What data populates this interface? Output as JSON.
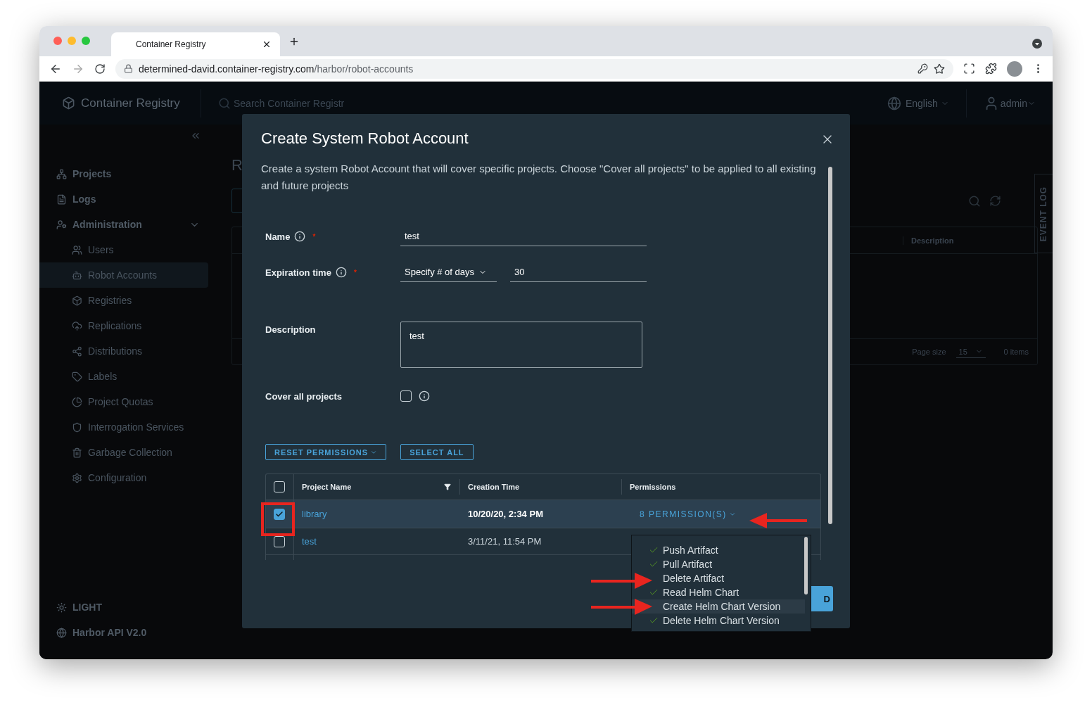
{
  "browser": {
    "tab_title": "Container Registry",
    "url_host": "determined-david.container-registry.com",
    "url_path": "/harbor/robot-accounts"
  },
  "app": {
    "brand": "Container Registry",
    "search_placeholder": "Search Container Registr",
    "language": "English",
    "user": "admin"
  },
  "sidebar": {
    "items": [
      {
        "label": "Projects",
        "kind": "top",
        "selected": false
      },
      {
        "label": "Logs",
        "kind": "top",
        "selected": false
      },
      {
        "label": "Administration",
        "kind": "group",
        "selected": false,
        "expanded": true,
        "children": [
          {
            "label": "Users",
            "selected": false
          },
          {
            "label": "Robot Accounts",
            "selected": true
          },
          {
            "label": "Registries",
            "selected": false
          },
          {
            "label": "Replications",
            "selected": false
          },
          {
            "label": "Distributions",
            "selected": false
          },
          {
            "label": "Labels",
            "selected": false
          },
          {
            "label": "Project Quotas",
            "selected": false
          },
          {
            "label": "Interrogation Services",
            "selected": false
          },
          {
            "label": "Garbage Collection",
            "selected": false
          },
          {
            "label": "Configuration",
            "selected": false
          }
        ]
      }
    ],
    "footer": [
      {
        "label": "LIGHT"
      },
      {
        "label": "Harbor API V2.0"
      }
    ]
  },
  "page": {
    "title": "R",
    "table": {
      "columns": [
        "Description"
      ],
      "page_size_label": "Page size",
      "page_size": "15",
      "item_count": "0 items"
    },
    "event_log": "EVENT LOG"
  },
  "modal": {
    "title": "Create System Robot Account",
    "description": "Create a system Robot Account that will cover specific projects. Choose \"Cover all projects\" to be applied to all existing and future projects",
    "fields": [
      {
        "kind": "text",
        "label": "Name",
        "info": true,
        "required_mark": "*",
        "value": "test"
      },
      {
        "kind": "expiration",
        "label": "Expiration time",
        "info": true,
        "required_mark": "*",
        "unit": "Specify # of days",
        "value": "30"
      },
      {
        "kind": "textarea",
        "label": "Description",
        "info": false,
        "value": "test"
      },
      {
        "kind": "checkbox",
        "label": "Cover all projects",
        "info": true,
        "checked": false
      }
    ],
    "buttons": [
      {
        "label": "RESET PERMISSIONS",
        "caret": true
      },
      {
        "label": "SELECT ALL",
        "caret": false
      }
    ],
    "table": {
      "all_checked": false,
      "columns": [
        "Project Name",
        "Creation Time",
        "Permissions"
      ],
      "rows": [
        {
          "name": "library",
          "created": "10/20/20, 2:34 PM",
          "permissions": "8 PERMISSION(S)",
          "selected": true
        },
        {
          "name": "test",
          "created": "3/11/21, 11:54 PM",
          "selected": false
        }
      ]
    },
    "permissions_menu": {
      "items": [
        {
          "label": "Push Artifact",
          "checked": true,
          "highlighted": false
        },
        {
          "label": "Pull Artifact",
          "checked": true,
          "highlighted": false
        },
        {
          "label": "Delete Artifact",
          "checked": false,
          "highlighted": false
        },
        {
          "label": "Read Helm Chart",
          "checked": true,
          "highlighted": false
        },
        {
          "label": "Create Helm Chart Version",
          "checked": false,
          "highlighted": true
        },
        {
          "label": "Delete Helm Chart Version",
          "checked": true,
          "highlighted": false
        }
      ]
    },
    "footer_button": "D"
  }
}
